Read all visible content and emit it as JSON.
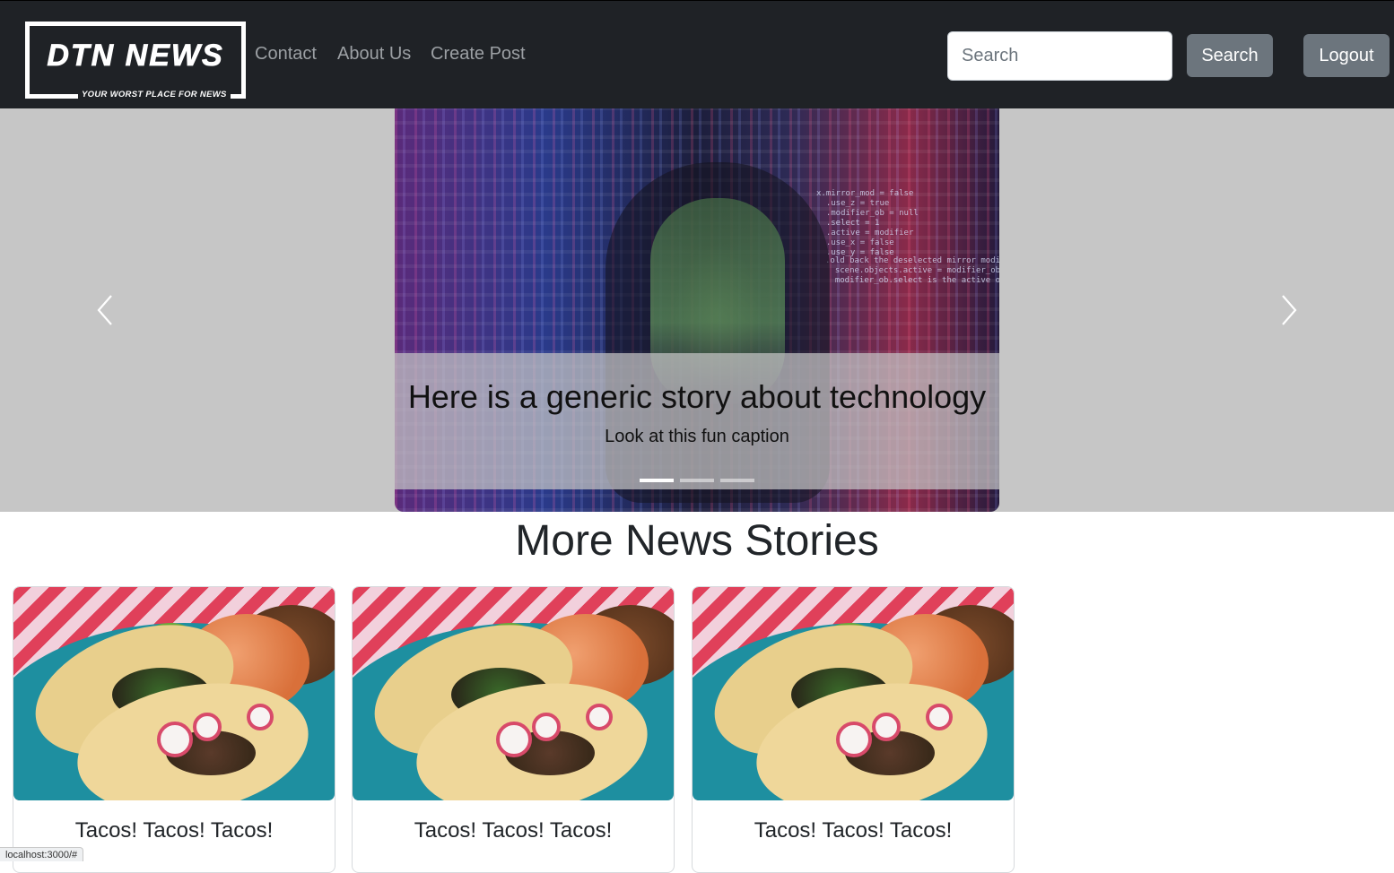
{
  "brand": {
    "name": "DTN NEWS",
    "tagline": "YOUR WORST PLACE FOR NEWS"
  },
  "nav": {
    "links": [
      {
        "label": "Contact"
      },
      {
        "label": "About Us"
      },
      {
        "label": "Create Post"
      }
    ],
    "search_placeholder": "Search",
    "search_button": "Search",
    "logout_button": "Logout"
  },
  "carousel": {
    "slide_title": "Here is a generic story about technology",
    "slide_caption": "Look at this fun caption",
    "indicator_count": 3,
    "active_index": 0,
    "prev_icon": "chevron-left-icon",
    "next_icon": "chevron-right-icon"
  },
  "section": {
    "title": "More News Stories"
  },
  "stories": [
    {
      "title": "Tacos! Tacos! Tacos!"
    },
    {
      "title": "Tacos! Tacos! Tacos!"
    },
    {
      "title": "Tacos! Tacos! Tacos!"
    }
  ],
  "status_bar": {
    "url": "localhost:3000/#"
  },
  "colors": {
    "navbar": "#1f2226",
    "button": "#6c757d",
    "carousel_bg": "#c6c6c6"
  }
}
